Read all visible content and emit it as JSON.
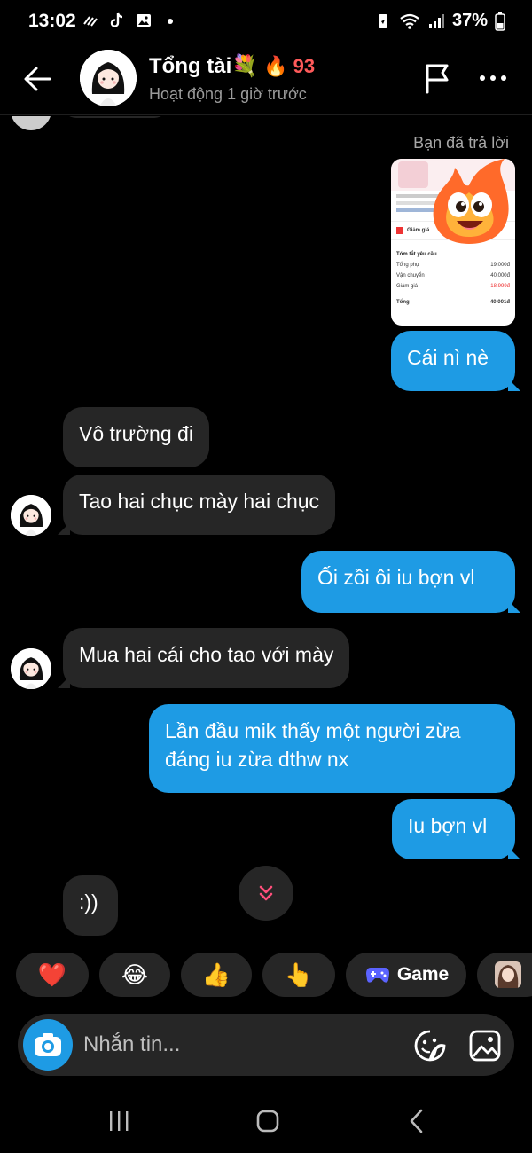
{
  "status_bar": {
    "time": "13:02",
    "battery": "37%"
  },
  "header": {
    "name": "Tổng tài💐",
    "streak_icon": "🔥",
    "streak_count": "93",
    "status": "Hoạt động 1 giờ trước"
  },
  "chat": {
    "replied_label": "Bạn đã trả lời",
    "reply_card": {
      "section_title": "Tóm tắt yêu cầu",
      "rows": [
        {
          "label": "Tổng phụ",
          "value": "19.000đ"
        },
        {
          "label": "Vận chuyển",
          "value": "40.000đ"
        },
        {
          "label": "Giảm giá",
          "value": "- 18.999đ"
        },
        {
          "label": "Tổng",
          "value": "40.001đ"
        }
      ],
      "voucher_label": "Giảm giá"
    },
    "messages": [
      {
        "dir": "out",
        "text": "Cái nì nè"
      },
      {
        "dir": "in",
        "text": "Vô trường đi"
      },
      {
        "dir": "in",
        "text": "Tao hai chục mày hai chục"
      },
      {
        "dir": "out",
        "text": "Ối zồi ôi iu bợn vl"
      },
      {
        "dir": "in",
        "text": "Mua hai cái cho tao với mày"
      },
      {
        "dir": "out",
        "text": "Lần đầu mik thấy một người zừa đáng iu zừa dthw nx"
      },
      {
        "dir": "out",
        "text": "Iu bợn vl"
      },
      {
        "dir": "in",
        "text": ":))"
      }
    ]
  },
  "reactions": [
    {
      "emoji": "❤️"
    },
    {
      "emoji": "😂"
    },
    {
      "emoji": "👍"
    },
    {
      "emoji": "👆"
    },
    {
      "label": "Game",
      "icon": "gamepad-icon"
    }
  ],
  "composer": {
    "placeholder": "Nhắn tin..."
  },
  "colors": {
    "accent": "#1e9be4",
    "incoming_bubble": "#262626",
    "background": "#000000",
    "streak": "#ff5a5a"
  }
}
